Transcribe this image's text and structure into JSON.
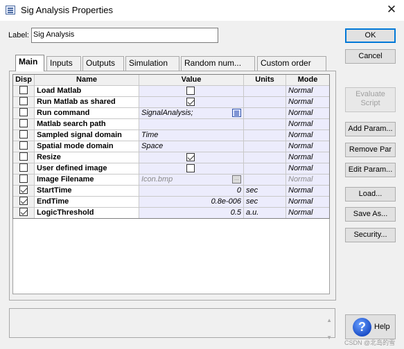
{
  "window": {
    "title": "Sig Analysis Properties",
    "close_glyph": "✕"
  },
  "label_field": {
    "label": "Label:",
    "value": "Sig Analysis"
  },
  "tabs": [
    "Main",
    "Inputs",
    "Outputs",
    "Simulation",
    "Random num...",
    "Custom order"
  ],
  "columns": {
    "disp": "Disp",
    "name": "Name",
    "value": "Value",
    "units": "Units",
    "mode": "Mode"
  },
  "rows": [
    {
      "disp": false,
      "name": "Load Matlab",
      "value_type": "checkbox",
      "checked": false,
      "units": "",
      "mode": "Normal"
    },
    {
      "disp": false,
      "name": "Run Matlab as shared",
      "value_type": "checkbox",
      "checked": true,
      "units": "",
      "mode": "Normal"
    },
    {
      "disp": false,
      "name": "Run command",
      "value": "SignalAnalysis;",
      "value_type": "text-list",
      "units": "",
      "mode": "Normal"
    },
    {
      "disp": false,
      "name": "Matlab search path",
      "value": "",
      "value_type": "text",
      "units": "",
      "mode": "Normal"
    },
    {
      "disp": false,
      "name": "Sampled signal domain",
      "value": "Time",
      "value_type": "text",
      "units": "",
      "mode": "Normal"
    },
    {
      "disp": false,
      "name": "Spatial mode domain",
      "value": "Space",
      "value_type": "text",
      "units": "",
      "mode": "Normal"
    },
    {
      "disp": false,
      "name": "Resize",
      "value_type": "checkbox",
      "checked": true,
      "units": "",
      "mode": "Normal"
    },
    {
      "disp": false,
      "name": "User defined image",
      "value_type": "checkbox",
      "checked": false,
      "units": "",
      "mode": "Normal"
    },
    {
      "disp": false,
      "name": "Image Filename",
      "value": "Icon.bmp",
      "value_type": "text-browse",
      "units": "",
      "mode": "Normal",
      "disabled": true
    },
    {
      "disp": true,
      "name": "StartTime",
      "value": "0",
      "value_type": "number",
      "units": "sec",
      "mode": "Normal"
    },
    {
      "disp": true,
      "name": "EndTime",
      "value": "0.8e-006",
      "value_type": "number",
      "units": "sec",
      "mode": "Normal"
    },
    {
      "disp": true,
      "name": "LogicThreshold",
      "value": "0.5",
      "value_type": "number",
      "units": "a.u.",
      "mode": "Normal"
    }
  ],
  "buttons": {
    "ok": "OK",
    "cancel": "Cancel",
    "evaluate_line1": "Evaluate",
    "evaluate_line2": "Script",
    "add_param": "Add Param...",
    "remove_param": "Remove Par",
    "edit_param": "Edit Param...",
    "load": "Load...",
    "save_as": "Save As...",
    "security": "Security...",
    "help": "Help",
    "browse_glyph": "..."
  },
  "help_icon_glyph": "?",
  "status": {
    "up": "▲",
    "down": "▼"
  },
  "watermark": "CSDN @北岛的雪"
}
